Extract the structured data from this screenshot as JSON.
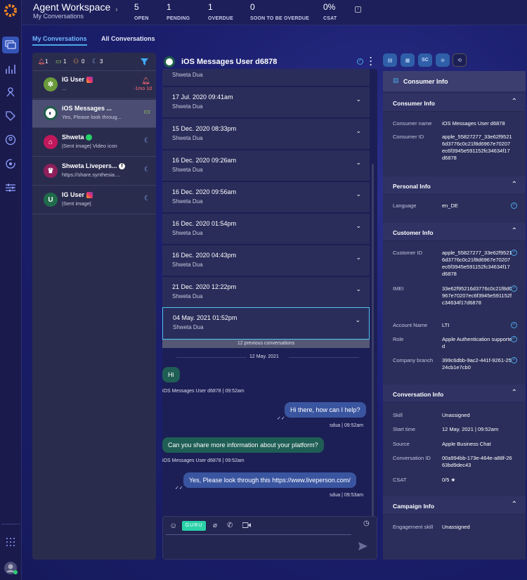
{
  "app": {
    "title": "Agent Workspace",
    "subtitle": "My Conversations"
  },
  "stats": [
    {
      "value": "5",
      "label": "OPEN"
    },
    {
      "value": "1",
      "label": "PENDING"
    },
    {
      "value": "1",
      "label": "OVERDUE"
    },
    {
      "value": "0",
      "label": "SOON TO BE OVERDUE"
    },
    {
      "value": "0%",
      "label": "CSAT"
    }
  ],
  "tabs": {
    "mine": "My Conversations",
    "all": "All Conversations"
  },
  "filters": {
    "alerts": "1",
    "messages": "1",
    "users": "0",
    "away": "3"
  },
  "conversations": [
    {
      "name": "IG User",
      "sub": "...",
      "time": "-1mo 1d",
      "avatar": "✲"
    },
    {
      "name": "iOS Messages ...",
      "sub": "Yes, Please look throug...",
      "time": "",
      "avatar": "◐"
    },
    {
      "name": "Shweta",
      "sub": "|Sent image| Video icon",
      "time": "",
      "avatar": "⌂"
    },
    {
      "name": "Shweta Livepers...",
      "sub": "https://share.synthesia....",
      "time": "",
      "avatar": "♛"
    },
    {
      "name": "IG User",
      "sub": "|Sent image|",
      "time": "",
      "avatar": "U"
    }
  ],
  "chat": {
    "title": "iOS Messages User d6878",
    "first_agent": "Shweta Dua",
    "history": [
      {
        "date": "17 Jul. 2020 09:41am",
        "agent": "Shweta Dua"
      },
      {
        "date": "15 Dec. 2020 08:33pm",
        "agent": "Shweta Dua"
      },
      {
        "date": "16 Dec. 2020 09:26am",
        "agent": "Shweta Dua"
      },
      {
        "date": "16 Dec. 2020 09:56am",
        "agent": "Shweta Dua"
      },
      {
        "date": "16 Dec. 2020 01:54pm",
        "agent": "Shweta Dua"
      },
      {
        "date": "16 Dec. 2020 04:43pm",
        "agent": "Shweta Dua"
      },
      {
        "date": "21 Dec. 2020 12:22pm",
        "agent": "Shweta Dua"
      },
      {
        "date": "04 May. 2021 01:52pm",
        "agent": "Shweta Dua"
      }
    ],
    "previous": "12 previous conversations",
    "day": "12 May. 2021",
    "messages": [
      {
        "text": "Hi",
        "meta": "iOS Messages User d6878  |  09:52am"
      },
      {
        "text": "Hi there, how can I help?",
        "meta": "sdua  |  09:52am"
      },
      {
        "text": "Can you share more information about your platform?",
        "meta": "iOS Messages User d6878  |  09:52am"
      },
      {
        "text": "Yes, Please look through this https://www.liveperson.com/",
        "meta": "sdua  |  09:53am"
      }
    ],
    "guru": "GURU"
  },
  "info": {
    "header": "Consumer Info",
    "tab_sc": "SC",
    "consumer": {
      "title": "Consumer Info",
      "name_k": "Consumer name",
      "name_v": "iOS Messages User d6878",
      "id_k": "Consumer ID",
      "id_v": "apple_55827277_33e62f95216d3776c0c21f8d6967e70207ec6f3945e591152fc34634f17d6878"
    },
    "personal": {
      "title": "Personal Info",
      "lang_k": "Language",
      "lang_v": "en_DE"
    },
    "customer": {
      "title": "Customer Info",
      "cid_k": "Customer ID",
      "cid_v": "apple_55827277_33e62f95216d3776c0c21f8d6967e70207ec6f3945e591152fc34634f17d6878",
      "imei_k": "IMEI",
      "imei_v": "33e62f95216d3776c0c21f8d6967e70207ec6f3945e591152fc34634f17d6878",
      "acc_k": "Account Name",
      "acc_v": "LTI",
      "role_k": "Role",
      "role_v": "Apple Authentication supported",
      "branch_k": "Company branch",
      "branch_v": "399c6dbb-9ac2-441f-9261-2524cb1e7cb0"
    },
    "conversation": {
      "title": "Conversation Info",
      "skill_k": "Skill",
      "skill_v": "Unassigned",
      "start_k": "Start time",
      "start_v": "12 May. 2021 | 09:52am",
      "source_k": "Source",
      "source_v": "Apple Business Chat",
      "cid_k": "Conversation ID",
      "cid_v": "00a994bb-173e-464e-a88f-2663bd9dec43",
      "csat_k": "CSAT",
      "csat_v": "0/5"
    },
    "campaign": {
      "title": "Campaign Info",
      "eng_k": "Engagement skill",
      "eng_v": "Unassigned"
    }
  }
}
